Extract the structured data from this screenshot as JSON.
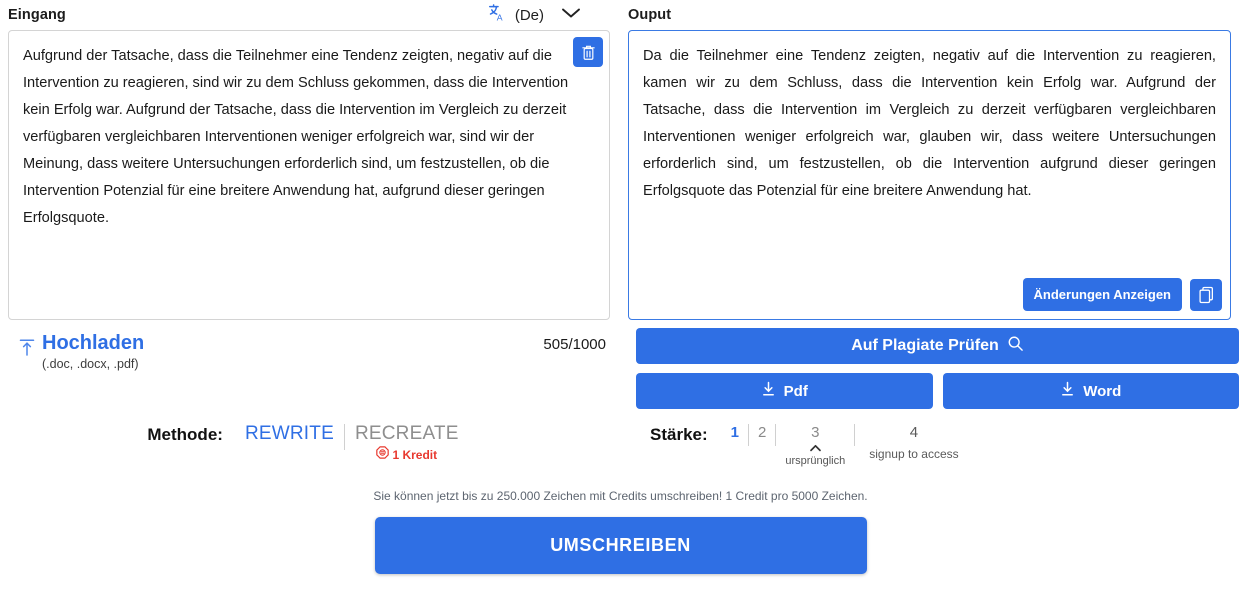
{
  "input_panel": {
    "title": "Eingang",
    "language_code": "(De)",
    "translate_icon": "translate-icon",
    "chevron_icon": "chevron-down-icon",
    "delete_icon": "trash-icon",
    "text": "Aufgrund der Tatsache, dass die Teilnehmer eine Tendenz zeigten, negativ auf die Intervention zu reagieren, sind wir zu dem Schluss gekommen, dass die Intervention kein Erfolg war. Aufgrund der Tatsache, dass die Intervention im Vergleich zu derzeit verfügbaren vergleichbaren Interventionen weniger erfolgreich war, sind wir der Meinung, dass weitere Untersuchungen erforderlich sind, um festzustellen, ob die Intervention Potenzial für eine breitere Anwendung hat, aufgrund dieser geringen Erfolgsquote.",
    "upload_label": "Hochladen",
    "upload_hint": "(.doc, .docx, .pdf)",
    "upload_icon": "upload-icon",
    "char_count": "505/1000"
  },
  "output_panel": {
    "title": "Ouput",
    "text": "Da die Teilnehmer eine Tendenz zeigten, negativ auf die Intervention zu reagieren, kamen wir zu dem Schluss, dass die Intervention kein Erfolg war. Aufgrund der Tatsache, dass die Intervention im Vergleich zu derzeit verfügbaren vergleichbaren Interventionen weniger erfolgreich war, glauben wir, dass weitere Untersuchungen erforderlich sind, um festzustellen, ob die Intervention aufgrund dieser geringen Erfolgsquote das Potenzial für eine breitere Anwendung hat.",
    "show_changes_label": "Änderungen Anzeigen",
    "copy_icon": "copy-icon",
    "plagiarism_label": "Auf Plagiate Prüfen",
    "plagiarism_icon": "search-icon",
    "pdf_label": "Pdf",
    "word_label": "Word",
    "download_icon": "download-icon"
  },
  "method": {
    "caption": "Methode:",
    "options": [
      {
        "label": "REWRITE",
        "active": true,
        "badge": null
      },
      {
        "label": "RECREATE",
        "active": false,
        "badge": "1 Kredit"
      }
    ],
    "credit_icon": "credit-coin-icon"
  },
  "strength": {
    "caption": "Stärke:",
    "levels": [
      {
        "value": "1",
        "state": "active",
        "sub": ""
      },
      {
        "value": "2",
        "state": "idle",
        "sub": ""
      },
      {
        "value": "3",
        "state": "idle",
        "sub": "ursprünglich",
        "caret": "⌃"
      },
      {
        "value": "4",
        "state": "locked",
        "sub": "signup to access"
      }
    ]
  },
  "footer": {
    "promo": "Sie können jetzt bis zu 250.000 Zeichen mit Credits umschreiben! 1 Credit pro 5000 Zeichen.",
    "cta_label": "UMSCHREIBEN"
  },
  "colors": {
    "accent_blue": "#2f6fe4",
    "credit_red": "#e8392f",
    "muted_gray": "#8a8a8a"
  }
}
